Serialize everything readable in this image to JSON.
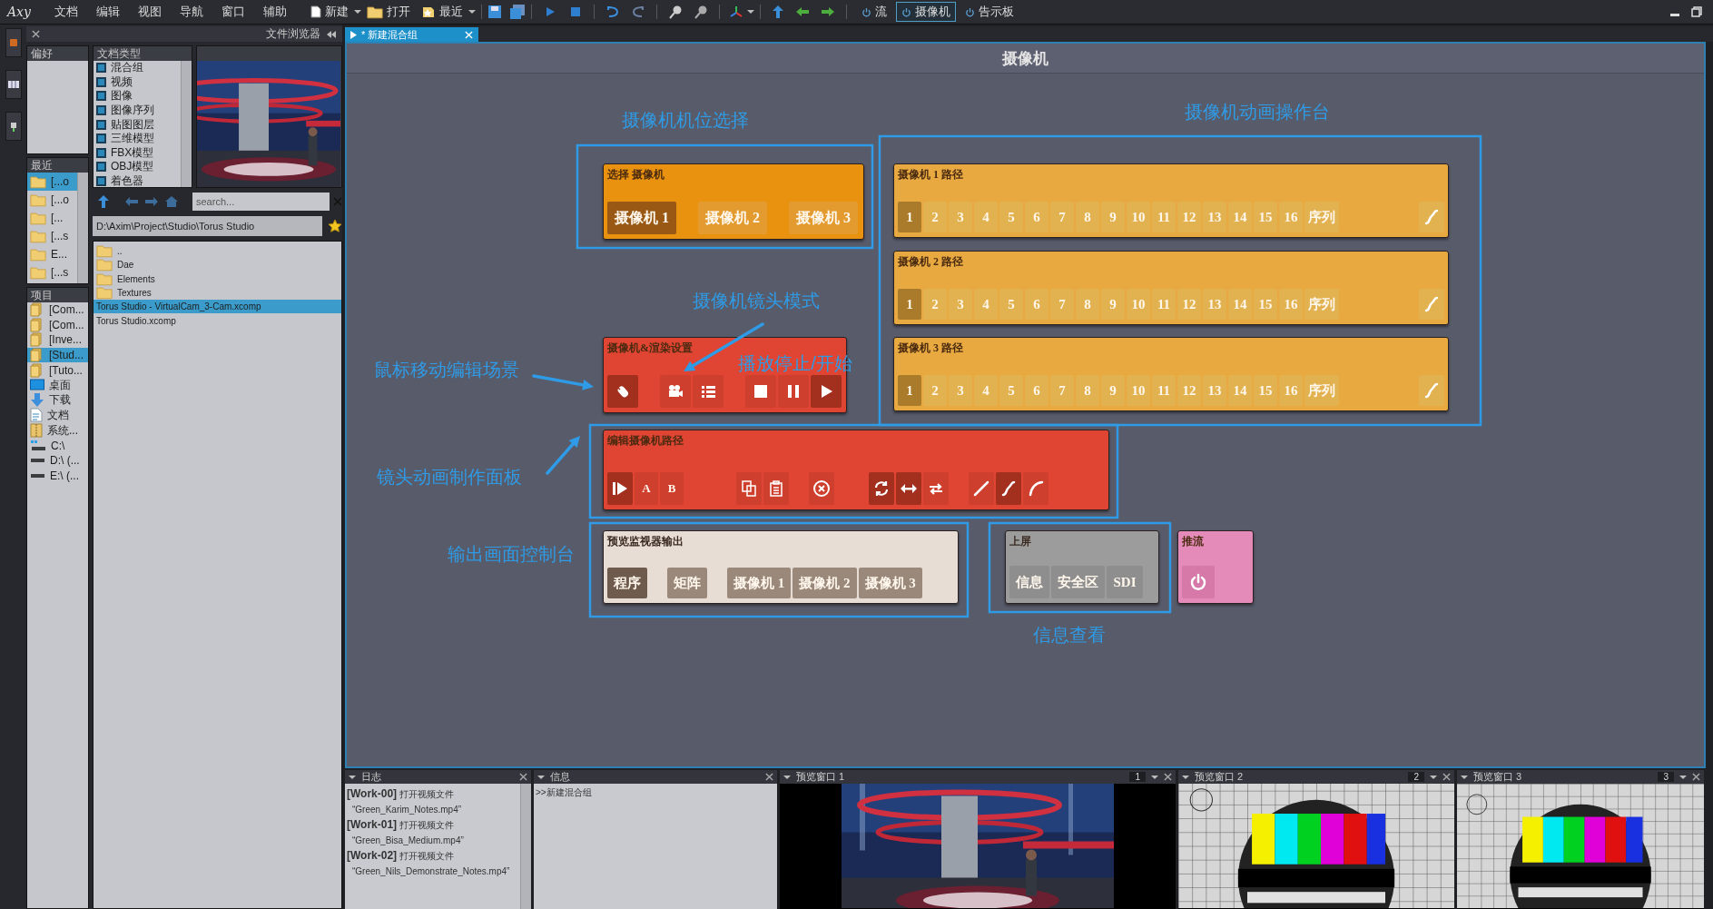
{
  "menu_bar": {
    "logo": "Axy",
    "menus": [
      "文档",
      "编辑",
      "视图",
      "导航",
      "窗口",
      "辅助"
    ],
    "toolbar": {
      "new": "新建",
      "open": "打开",
      "recent": "最近",
      "modes": [
        {
          "label": "流",
          "selected": false
        },
        {
          "label": "摄像机",
          "selected": true
        },
        {
          "label": "告示板",
          "selected": false
        }
      ]
    }
  },
  "file_browser": {
    "title": "文件浏览器",
    "favorites": {
      "title": "偏好"
    },
    "doc_types": {
      "title": "文档类型",
      "items": [
        {
          "label": "混合组",
          "checked": true
        },
        {
          "label": "视频",
          "checked": true
        },
        {
          "label": "图像",
          "checked": true
        },
        {
          "label": "图像序列",
          "checked": true
        },
        {
          "label": "贴图图层",
          "checked": true
        },
        {
          "label": "三维模型",
          "checked": true
        },
        {
          "label": "FBX模型",
          "checked": true
        },
        {
          "label": "OBJ模型",
          "checked": true
        },
        {
          "label": "着色器",
          "checked": true
        }
      ]
    },
    "recent": {
      "title": "最近",
      "items": [
        {
          "label": "[...o",
          "selected": true
        },
        {
          "label": "[...o",
          "selected": false
        },
        {
          "label": "[...",
          "selected": false
        },
        {
          "label": "[...s",
          "selected": false
        },
        {
          "label": "E...",
          "selected": false
        },
        {
          "label": "[...s",
          "selected": false
        }
      ]
    },
    "search": {
      "placeholder": "search..."
    },
    "path": "D:\\Axim\\Project\\Studio\\Torus Studio",
    "files": [
      {
        "name": "..",
        "kind": "folder",
        "selected": false
      },
      {
        "name": "Dae",
        "kind": "folder",
        "selected": false
      },
      {
        "name": "Elements",
        "kind": "folder",
        "selected": false
      },
      {
        "name": "Textures",
        "kind": "folder",
        "selected": false
      },
      {
        "name": "Torus Studio - VirtualCam_3-Cam.xcomp",
        "kind": "file",
        "selected": true
      },
      {
        "name": "Torus Studio.xcomp",
        "kind": "file",
        "selected": false
      }
    ],
    "projects": {
      "title": "项目",
      "items": [
        {
          "label": "[Com...",
          "kind": "project",
          "selected": false
        },
        {
          "label": "[Com...",
          "kind": "project",
          "selected": false
        },
        {
          "label": "[Inve...",
          "kind": "project",
          "selected": false
        },
        {
          "label": "[Stud...",
          "kind": "project",
          "selected": true
        },
        {
          "label": "[Tuto...",
          "kind": "project",
          "selected": false
        },
        {
          "label": "桌面",
          "kind": "desktop",
          "selected": false
        },
        {
          "label": "下载",
          "kind": "download",
          "selected": false
        },
        {
          "label": "文档",
          "kind": "document",
          "selected": false
        },
        {
          "label": "系统...",
          "kind": "archive",
          "selected": false
        },
        {
          "label": "C:\\",
          "kind": "system-drive",
          "selected": false
        },
        {
          "label": "D:\\  (...",
          "kind": "drive",
          "selected": false
        },
        {
          "label": "E:\\  (...",
          "kind": "drive",
          "selected": false
        }
      ]
    }
  },
  "document_tab": {
    "label": "* 新建混合组"
  },
  "canvas": {
    "title": "摄像机",
    "notes": [
      "摄像机机位选择",
      "摄像机动画操作台",
      "摄像机镜头模式",
      "鼠标移动编辑场景",
      "播放停止/开始",
      "镜头动画制作面板",
      "输出画面控制台",
      "信息查看"
    ],
    "panels": [
      {
        "kind": "camera-select",
        "title": "选择 摄像机",
        "buttons": [
          {
            "kind": "text",
            "label": "摄像机 1",
            "selected": true
          },
          {
            "kind": "text",
            "label": "摄像机 2",
            "selected": false
          },
          {
            "kind": "text",
            "label": "摄像机 3",
            "selected": false
          }
        ]
      },
      {
        "kind": "path",
        "title": "摄像机 1 路径",
        "buttons": [
          {
            "kind": "text",
            "label": "1",
            "selected": true
          },
          {
            "kind": "text",
            "label": "2",
            "selected": false
          },
          {
            "kind": "text",
            "label": "3",
            "selected": false
          },
          {
            "kind": "text",
            "label": "4",
            "selected": false
          },
          {
            "kind": "text",
            "label": "5",
            "selected": false
          },
          {
            "kind": "text",
            "label": "6",
            "selected": false
          },
          {
            "kind": "text",
            "label": "7",
            "selected": false
          },
          {
            "kind": "text",
            "label": "8",
            "selected": false
          },
          {
            "kind": "text",
            "label": "9",
            "selected": false
          },
          {
            "kind": "text",
            "label": "10",
            "selected": false
          },
          {
            "kind": "text",
            "label": "11",
            "selected": false
          },
          {
            "kind": "text",
            "label": "12",
            "selected": false
          },
          {
            "kind": "text",
            "label": "13",
            "selected": false
          },
          {
            "kind": "text",
            "label": "14",
            "selected": false
          },
          {
            "kind": "text",
            "label": "15",
            "selected": false
          },
          {
            "kind": "text",
            "label": "16",
            "selected": false
          },
          {
            "kind": "text",
            "label": "序列",
            "selected": false
          },
          {
            "kind": "icon",
            "selected": false
          }
        ]
      },
      {
        "kind": "path",
        "title": "摄像机 2 路径",
        "buttons": [
          {
            "kind": "text",
            "label": "1",
            "selected": true
          },
          {
            "kind": "text",
            "label": "2",
            "selected": false
          },
          {
            "kind": "text",
            "label": "3",
            "selected": false
          },
          {
            "kind": "text",
            "label": "4",
            "selected": false
          },
          {
            "kind": "text",
            "label": "5",
            "selected": false
          },
          {
            "kind": "text",
            "label": "6",
            "selected": false
          },
          {
            "kind": "text",
            "label": "7",
            "selected": false
          },
          {
            "kind": "text",
            "label": "8",
            "selected": false
          },
          {
            "kind": "text",
            "label": "9",
            "selected": false
          },
          {
            "kind": "text",
            "label": "10",
            "selected": false
          },
          {
            "kind": "text",
            "label": "11",
            "selected": false
          },
          {
            "kind": "text",
            "label": "12",
            "selected": false
          },
          {
            "kind": "text",
            "label": "13",
            "selected": false
          },
          {
            "kind": "text",
            "label": "14",
            "selected": false
          },
          {
            "kind": "text",
            "label": "15",
            "selected": false
          },
          {
            "kind": "text",
            "label": "16",
            "selected": false
          },
          {
            "kind": "text",
            "label": "序列",
            "selected": false
          },
          {
            "kind": "icon",
            "selected": false
          }
        ]
      },
      {
        "kind": "render",
        "title": "摄像机&渲染设置",
        "buttons": [
          {
            "kind": "icon",
            "selected": true
          },
          {
            "kind": "icon",
            "selected": false
          },
          {
            "kind": "icon",
            "selected": false
          },
          {
            "kind": "icon",
            "selected": false
          },
          {
            "kind": "icon",
            "selected": false
          },
          {
            "kind": "icon",
            "selected": true
          }
        ]
      },
      {
        "kind": "path",
        "title": "摄像机 3 路径",
        "buttons": [
          {
            "kind": "text",
            "label": "1",
            "selected": true
          },
          {
            "kind": "text",
            "label": "2",
            "selected": false
          },
          {
            "kind": "text",
            "label": "3",
            "selected": false
          },
          {
            "kind": "text",
            "label": "4",
            "selected": false
          },
          {
            "kind": "text",
            "label": "5",
            "selected": false
          },
          {
            "kind": "text",
            "label": "6",
            "selected": false
          },
          {
            "kind": "text",
            "label": "7",
            "selected": false
          },
          {
            "kind": "text",
            "label": "8",
            "selected": false
          },
          {
            "kind": "text",
            "label": "9",
            "selected": false
          },
          {
            "kind": "text",
            "label": "10",
            "selected": false
          },
          {
            "kind": "text",
            "label": "11",
            "selected": false
          },
          {
            "kind": "text",
            "label": "12",
            "selected": false
          },
          {
            "kind": "text",
            "label": "13",
            "selected": false
          },
          {
            "kind": "text",
            "label": "14",
            "selected": false
          },
          {
            "kind": "text",
            "label": "15",
            "selected": false
          },
          {
            "kind": "text",
            "label": "16",
            "selected": false
          },
          {
            "kind": "text",
            "label": "序列",
            "selected": false
          },
          {
            "kind": "icon",
            "selected": false
          }
        ]
      },
      {
        "kind": "edit-path",
        "title": "编辑摄像机路径",
        "buttons": [
          {
            "kind": "icon",
            "selected": true
          },
          {
            "kind": "text",
            "label": "A",
            "selected": false
          },
          {
            "kind": "text",
            "label": "B",
            "selected": false
          },
          {
            "kind": "icon",
            "selected": false
          },
          {
            "kind": "icon",
            "selected": false
          },
          {
            "kind": "icon",
            "selected": false
          },
          {
            "kind": "icon",
            "selected": true
          },
          {
            "kind": "icon",
            "selected": true
          },
          {
            "kind": "icon",
            "selected": false
          },
          {
            "kind": "icon",
            "selected": false
          },
          {
            "kind": "icon",
            "selected": true
          },
          {
            "kind": "icon",
            "selected": false
          }
        ]
      },
      {
        "kind": "monitor",
        "title": "预览监视器输出",
        "buttons": [
          {
            "kind": "text",
            "label": "程序",
            "selected": true
          },
          {
            "kind": "text",
            "label": "矩阵",
            "selected": false
          },
          {
            "kind": "text",
            "label": "摄像机 1",
            "selected": false
          },
          {
            "kind": "text",
            "label": "摄像机 2",
            "selected": false
          },
          {
            "kind": "text",
            "label": "摄像机 3",
            "selected": false
          }
        ]
      },
      {
        "kind": "screen",
        "title": "上屏",
        "buttons": [
          {
            "kind": "text",
            "label": "信息",
            "selected": false
          },
          {
            "kind": "text",
            "label": "安全区",
            "selected": false
          },
          {
            "kind": "text",
            "label": "SDI",
            "selected": false
          }
        ]
      },
      {
        "kind": "stream",
        "title": "推流",
        "buttons": [
          {
            "kind": "icon",
            "selected": false
          }
        ]
      }
    ]
  },
  "bottom_panels": [
    {
      "kind": "log",
      "title": "日志",
      "lines": [
        {
          "kind": "entry",
          "tag": "[Work-00]",
          "text": "打开视频文件"
        },
        {
          "kind": "file",
          "text": "“Green_Karim_Notes.mp4”"
        },
        {
          "kind": "entry",
          "tag": "[Work-01]",
          "text": "打开视频文件"
        },
        {
          "kind": "file",
          "text": "“Green_Bisa_Medium.mp4”"
        },
        {
          "kind": "entry",
          "tag": "[Work-02]",
          "text": "打开视频文件"
        },
        {
          "kind": "file",
          "text": "“Green_Nils_Demonstrate_Notes.mp4”"
        }
      ]
    },
    {
      "kind": "info",
      "title": "信息",
      "lines": [
        {
          "kind": "plain",
          "text": ">>新建混合组"
        }
      ]
    },
    {
      "kind": "preview",
      "title": "预览窗口 1",
      "number": "1"
    },
    {
      "kind": "preview",
      "title": "预览窗口 2",
      "number": "2"
    },
    {
      "kind": "preview",
      "title": "预览窗口 3",
      "number": "3"
    }
  ]
}
